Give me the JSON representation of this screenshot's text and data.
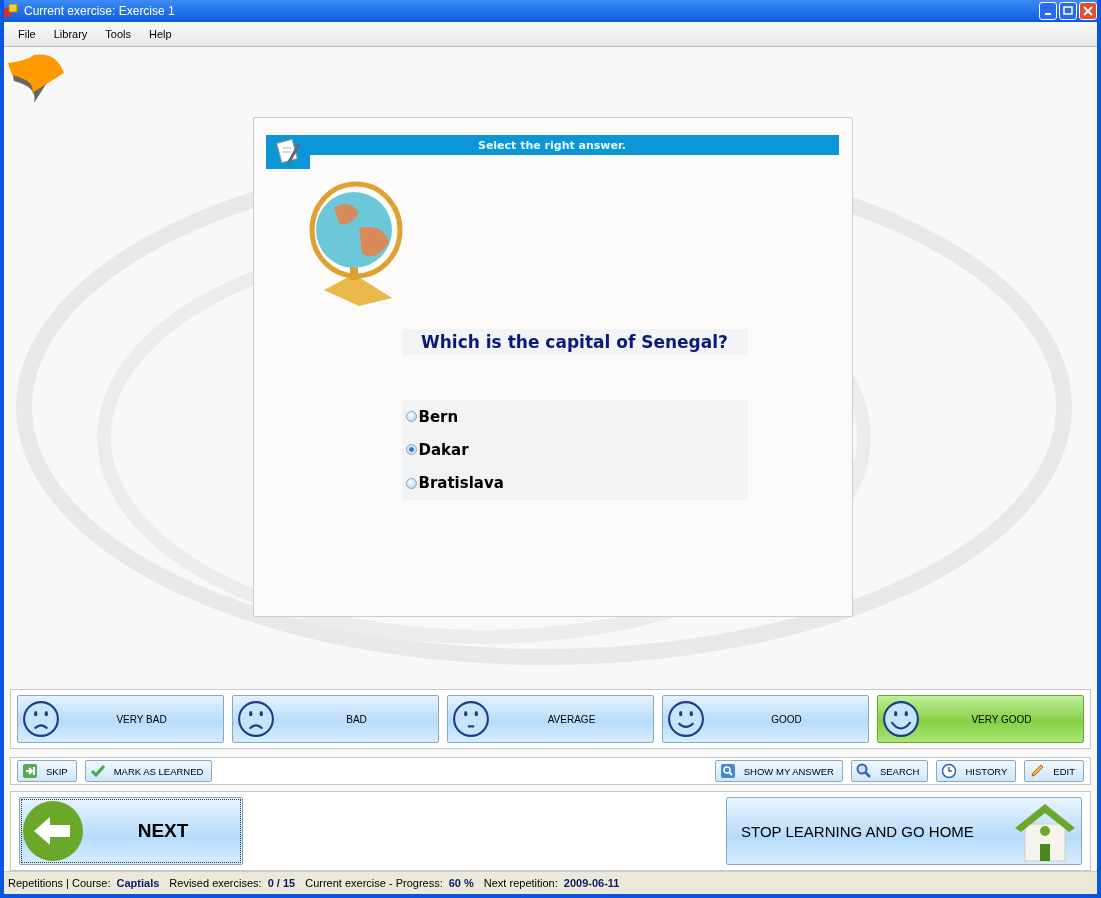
{
  "window": {
    "title": "Current exercise: Exercise 1"
  },
  "menu": [
    "File",
    "Library",
    "Tools",
    "Help"
  ],
  "exercise": {
    "instruction": "Select the right answer.",
    "question": "Which is the capital of Senegal?",
    "answers": [
      {
        "label": "Bern",
        "selected": false
      },
      {
        "label": "Dakar",
        "selected": true
      },
      {
        "label": "Bratislava",
        "selected": false
      }
    ]
  },
  "ratings": [
    {
      "label": "VERY BAD",
      "kind": "frown",
      "selected": false
    },
    {
      "label": "BAD",
      "kind": "frown",
      "selected": false
    },
    {
      "label": "AVERAGE",
      "kind": "flat",
      "selected": false
    },
    {
      "label": "GOOD",
      "kind": "smile",
      "selected": false
    },
    {
      "label": "VERY GOOD",
      "kind": "grin",
      "selected": true
    }
  ],
  "tools_left": [
    {
      "label": "SKIP",
      "kind": "skip"
    },
    {
      "label": "MARK AS LEARNED",
      "kind": "check"
    }
  ],
  "tools_right": [
    {
      "label": "SHOW MY ANSWER",
      "kind": "show"
    },
    {
      "label": "SEARCH",
      "kind": "search"
    },
    {
      "label": "HISTORY",
      "kind": "clock"
    },
    {
      "label": "EDIT",
      "kind": "pencil"
    }
  ],
  "next_button": "NEXT",
  "home_button": "STOP LEARNING AND GO HOME",
  "status_bar": [
    {
      "label": "Repetitions | Course:",
      "value": "Captials"
    },
    {
      "label": "Revised exercises:",
      "value": "0 / 15"
    },
    {
      "label": "Current exercise - Progress:",
      "value": "60 %"
    },
    {
      "label": "Next repetition:",
      "value": "2009-06-11"
    }
  ]
}
